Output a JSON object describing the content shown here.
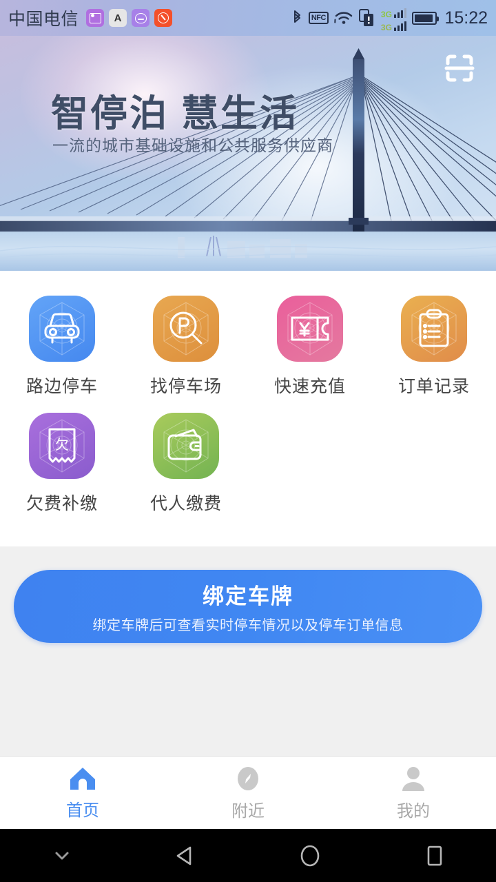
{
  "status_bar": {
    "carrier": "中国电信",
    "time": "15:22",
    "notif_icons": [
      "photo-icon",
      "keyboard-icon",
      "emoji-icon",
      "tool-icon"
    ],
    "keyboard_glyph": "A",
    "nfc_label": "NFC",
    "network_type_1": "3G",
    "network_type_2": "3G",
    "system_icons": [
      "bluetooth-icon",
      "nfc-icon",
      "wifi-icon",
      "dual-sim-icon",
      "signal-icon",
      "battery-icon"
    ]
  },
  "banner": {
    "title": "智停泊 慧生活",
    "subtitle": "一流的城市基础设施和公共服务供应商",
    "scan_icon": "scan-qr-icon"
  },
  "grid": {
    "items": [
      {
        "label": "路边停车",
        "icon": "car-icon",
        "color_from": "#63a4f7",
        "color_to": "#4588ef"
      },
      {
        "label": "找停车场",
        "icon": "parking-search-icon",
        "color_from": "#e8a851",
        "color_to": "#dd8f3c"
      },
      {
        "label": "快速充值",
        "icon": "recharge-ticket-icon",
        "color_from": "#ea5f9b",
        "color_to": "#e4739f"
      },
      {
        "label": "订单记录",
        "icon": "clipboard-icon",
        "color_from": "#eab050",
        "color_to": "#e08c4a"
      },
      {
        "label": "欠费补缴",
        "icon": "arrears-receipt-icon",
        "color_from": "#a069d8",
        "color_to": "#8a5ccd"
      },
      {
        "label": "代人缴费",
        "icon": "wallet-icon",
        "color_from": "#a4c95a",
        "color_to": "#76b453"
      }
    ]
  },
  "cta": {
    "title": "绑定车牌",
    "subtitle": "绑定车牌后可查看实时停车情况以及停车订单信息",
    "color": "#4087f2"
  },
  "tabbar": {
    "active_color": "#4a8ef0",
    "inactive_color": "#a8a8a8",
    "tabs": [
      {
        "label": "首页",
        "icon": "home-icon",
        "active": true
      },
      {
        "label": "附近",
        "icon": "compass-icon",
        "active": false
      },
      {
        "label": "我的",
        "icon": "person-icon",
        "active": false
      }
    ]
  },
  "android_nav": {
    "buttons": [
      "hide-nav-icon",
      "back-icon",
      "home-icon",
      "recents-icon"
    ]
  }
}
